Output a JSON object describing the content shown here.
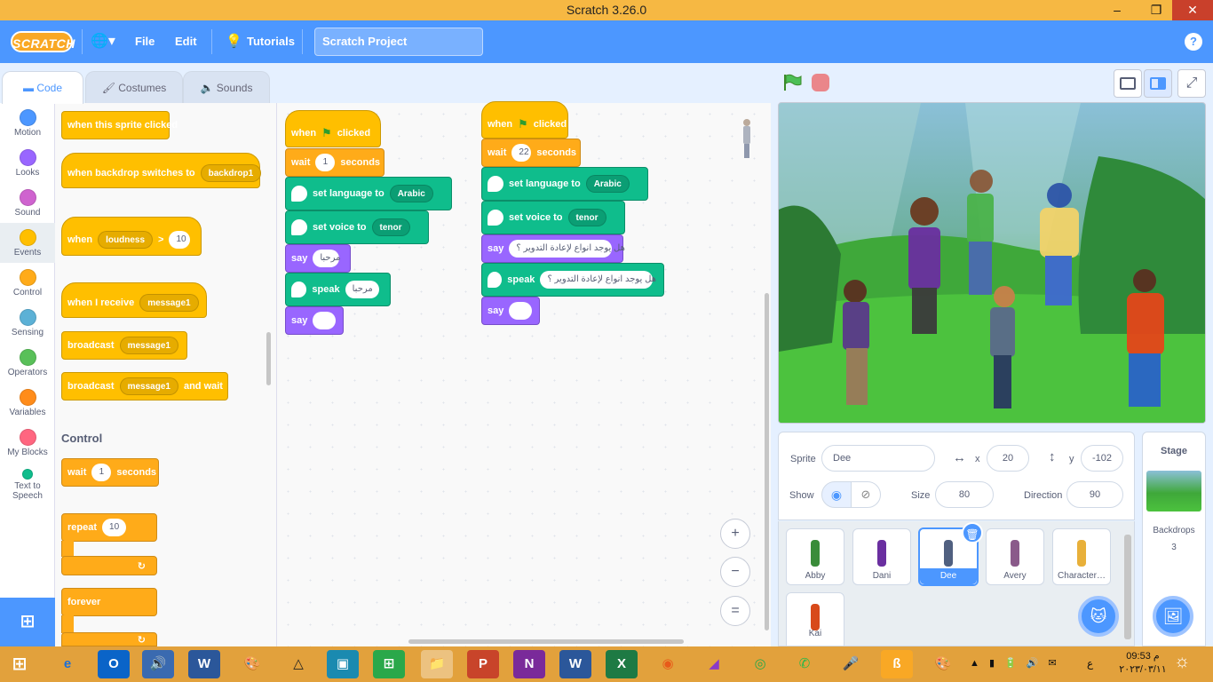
{
  "window": {
    "title": "Scratch 3.26.0",
    "min": "–",
    "max": "❐",
    "close": "✕"
  },
  "menubar": {
    "logo": "SCRATCH",
    "globe": "🌐▾",
    "file": "File",
    "edit": "Edit",
    "tutorials": "Tutorials",
    "project_title": "Scratch Project",
    "help": "?"
  },
  "tabs": {
    "code": "Code",
    "costumes": "Costumes",
    "sounds": "Sounds"
  },
  "categories": [
    {
      "label": "Motion",
      "color": "#4c97ff"
    },
    {
      "label": "Looks",
      "color": "#9966ff"
    },
    {
      "label": "Sound",
      "color": "#cf63cf"
    },
    {
      "label": "Events",
      "color": "#ffbf00"
    },
    {
      "label": "Control",
      "color": "#ffab19"
    },
    {
      "label": "Sensing",
      "color": "#5cb1d6"
    },
    {
      "label": "Operators",
      "color": "#59c059"
    },
    {
      "label": "Variables",
      "color": "#ff8c1a"
    },
    {
      "label": "My Blocks",
      "color": "#ff6680"
    },
    {
      "label": "Text to Speech",
      "color": "#0fbd8c"
    }
  ],
  "palette": {
    "sprite_clicked": "when this sprite clicked",
    "backdrop_switch": "when backdrop switches to",
    "backdrop_val": "backdrop1",
    "when": "when",
    "loudness": "loudness",
    "gt": ">",
    "loud_val": "10",
    "receive": "when I receive",
    "msg": "message1",
    "broadcast": "broadcast",
    "and_wait": "and wait",
    "control_title": "Control",
    "wait": "wait",
    "wait_val": "1",
    "seconds": "seconds",
    "repeat": "repeat",
    "repeat_val": "10",
    "forever": "forever"
  },
  "script1": {
    "when": "when",
    "clicked": "clicked",
    "wait": "wait",
    "wait_val": "1",
    "seconds": "seconds",
    "set_lang": "set language to",
    "lang": "Arabic",
    "set_voice": "set voice to",
    "voice": "tenor",
    "say": "say",
    "say_val": "مرحبا",
    "speak": "speak",
    "speak_val": "مرحبا",
    "say2": "say",
    "say2_val": ""
  },
  "script2": {
    "when": "when",
    "clicked": "clicked",
    "wait": "wait",
    "wait_val": "22",
    "seconds": "seconds",
    "set_lang": "set language to",
    "lang": "Arabic",
    "set_voice": "set voice to",
    "voice": "tenor",
    "say": "say",
    "say_val": "هل يوجد انواع لإعادة التدوير ؟",
    "speak": "speak",
    "speak_val": "هل يوجد انواع لإعادة التدوير ؟",
    "say2": "say",
    "say2_val": ""
  },
  "zoom": {
    "in": "+",
    "out": "−",
    "reset": "="
  },
  "sprite_info": {
    "sprite_label": "Sprite",
    "sprite_name": "Dee",
    "x_label": "x",
    "x": "20",
    "y_label": "y",
    "y": "-102",
    "show_label": "Show",
    "size_label": "Size",
    "size": "80",
    "direction_label": "Direction",
    "direction": "90"
  },
  "sprites": [
    {
      "name": "Abby",
      "color": "#3a8c3a"
    },
    {
      "name": "Dani",
      "color": "#6a2fa0"
    },
    {
      "name": "Dee",
      "color": "#506080"
    },
    {
      "name": "Avery",
      "color": "#8a5a8a"
    },
    {
      "name": "Character…",
      "color": "#e8b03a"
    },
    {
      "name": "Kai",
      "color": "#d84a1a"
    }
  ],
  "stage_panel": {
    "title": "Stage",
    "backdrops": "Backdrops",
    "count": "3"
  },
  "taskbar": {
    "time": "09:53 م",
    "date": "٢٠٢٣/٠٣/١١",
    "lang": "ع"
  }
}
